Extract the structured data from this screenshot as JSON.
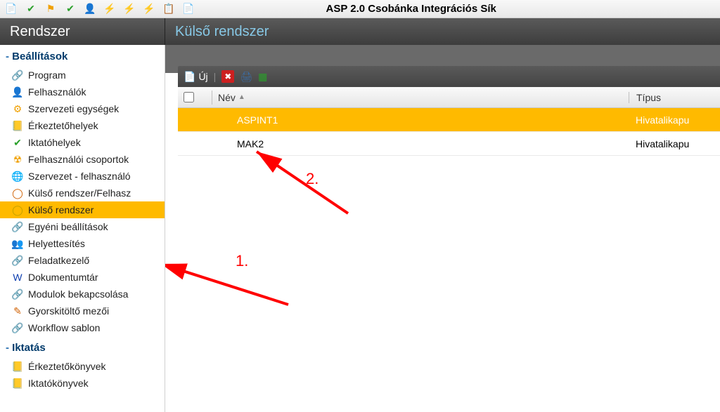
{
  "app": {
    "title": "ASP 2.0 Csobánka Integrációs Sík"
  },
  "header": {
    "left": "Rendszer",
    "right": "Külső rendszer"
  },
  "toolbar": {
    "new_label": "Új"
  },
  "columns": {
    "name": "Név",
    "type": "Típus"
  },
  "rows": [
    {
      "name": "ASPINT1",
      "type": "Hivatalikapu",
      "selected": true
    },
    {
      "name": "MAK2",
      "type": "Hivatalikapu",
      "selected": false
    }
  ],
  "annotations": {
    "label1": "1.",
    "label2": "2."
  },
  "sidebar": {
    "sections": [
      {
        "title": "Beállítások",
        "items": [
          {
            "label": "Program",
            "icon": "🔗",
            "color": "#2a90d0"
          },
          {
            "label": "Felhasználók",
            "icon": "👤",
            "color": "#2a90d0"
          },
          {
            "label": "Szervezeti egységek",
            "icon": "⚙",
            "color": "#f0a000"
          },
          {
            "label": "Érkeztetőhelyek",
            "icon": "📒",
            "color": "#f0a000"
          },
          {
            "label": "Iktatóhelyek",
            "icon": "✔",
            "color": "#2aa02a"
          },
          {
            "label": "Felhasználói csoportok",
            "icon": "☢",
            "color": "#f0a000"
          },
          {
            "label": "Szervezet - felhasználó",
            "icon": "🌐",
            "color": "#2aa02a"
          },
          {
            "label": "Külső rendszer/Felhasz",
            "icon": "◯",
            "color": "#d06000"
          },
          {
            "label": "Külső rendszer",
            "icon": "◯",
            "color": "#c0a000",
            "selected": true
          },
          {
            "label": "Egyéni beállítások",
            "icon": "🔗",
            "color": "#2a90d0"
          },
          {
            "label": "Helyettesítés",
            "icon": "👥",
            "color": "#f0a000"
          },
          {
            "label": "Feladatkezelő",
            "icon": "🔗",
            "color": "#d02020"
          },
          {
            "label": "Dokumentumtár",
            "icon": "W",
            "color": "#1040b0"
          },
          {
            "label": "Modulok bekapcsolása",
            "icon": "🔗",
            "color": "#f0a000"
          },
          {
            "label": "Gyorskitöltő mezői",
            "icon": "✎",
            "color": "#d06000"
          },
          {
            "label": "Workflow sablon",
            "icon": "🔗",
            "color": "#808080"
          }
        ]
      },
      {
        "title": "Iktatás",
        "items": [
          {
            "label": "Érkeztetőkönyvek",
            "icon": "📒",
            "color": "#f0a000"
          },
          {
            "label": "Iktatókönyvek",
            "icon": "📒",
            "color": "#f0a000"
          }
        ]
      }
    ]
  }
}
